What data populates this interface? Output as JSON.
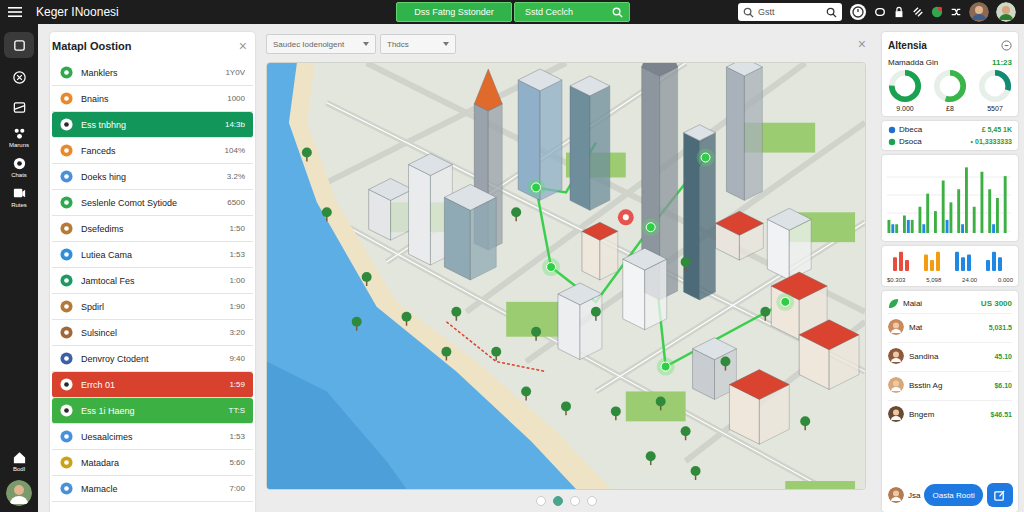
{
  "topbar": {
    "title": "Keger INoonesi",
    "action_button": "Dss Fatng Sstonder",
    "green_search": {
      "value": "Sstd Ceclch"
    },
    "search": {
      "placeholder": "Gstt"
    }
  },
  "rail": {
    "items": [
      {
        "label": "",
        "selected": true
      },
      {
        "label": "",
        "selected": false
      },
      {
        "label": "",
        "selected": false
      },
      {
        "label": "Maruns",
        "selected": false
      },
      {
        "label": "Chats",
        "selected": false
      },
      {
        "label": "Rutes",
        "selected": false
      }
    ],
    "bottom_label": "Bodl"
  },
  "left_panel": {
    "title": "Matapl Oostion",
    "close": "×",
    "items": [
      {
        "name": "Manklers",
        "value": "1Y0V",
        "kind": "plain",
        "color": "#2fa84f"
      },
      {
        "name": "Bnains",
        "value": "1000",
        "kind": "plain",
        "color": "#e8892b"
      },
      {
        "name": "Ess tnbhng",
        "value": "14:3b",
        "kind": "active",
        "color": "#ffffff"
      },
      {
        "name": "Fanceds",
        "value": "104%",
        "kind": "plain",
        "color": "#e8892b"
      },
      {
        "name": "Doeks hing",
        "value": "3.2%",
        "kind": "plain",
        "color": "#4a90d9"
      },
      {
        "name": "Seslenle Comot Sytiode",
        "value": "6500",
        "kind": "plain",
        "color": "#2fa84f"
      },
      {
        "name": "Dsefedims",
        "value": "1:50",
        "kind": "plain",
        "color": "#b5793a"
      },
      {
        "name": "Lutiea Cama",
        "value": "1:53",
        "kind": "plain",
        "color": "#2f8fd9"
      },
      {
        "name": "Jamtocal Fes",
        "value": "1:00",
        "kind": "plain",
        "color": "#1d9a63"
      },
      {
        "name": "Spdirl",
        "value": "1:90",
        "kind": "plain",
        "color": "#b5793a"
      },
      {
        "name": "Sulsincel",
        "value": "3:20",
        "kind": "plain",
        "color": "#a0673a"
      },
      {
        "name": "Denvroy Ctodent",
        "value": "9:40",
        "kind": "plain",
        "color": "#3d5fa8"
      },
      {
        "name": "Errch 01",
        "value": "1:59",
        "kind": "alert",
        "color": "#ffffff"
      },
      {
        "name": "Ess 1i Haeng",
        "value": "TT:S",
        "kind": "success",
        "color": "#ffffff"
      },
      {
        "name": "Uesaalcimes",
        "value": "1:53",
        "kind": "plain",
        "color": "#4a90d9"
      },
      {
        "name": "Matadara",
        "value": "5:60",
        "kind": "plain",
        "color": "#c9a21a"
      },
      {
        "name": "Mamacle",
        "value": "7:00",
        "kind": "plain",
        "color": "#4a90d9"
      }
    ]
  },
  "map": {
    "filters": [
      {
        "label": "Saudec Iodenolgent"
      },
      {
        "label": "Thdcs"
      }
    ],
    "close": "×",
    "pages": [
      {
        "selected": false
      },
      {
        "selected": true
      },
      {
        "selected": false
      },
      {
        "selected": false
      }
    ]
  },
  "right_panel": {
    "title": "Altensia",
    "summary": {
      "label": "Mamadda Gin",
      "value": "11:23"
    },
    "gauges": [
      {
        "level": 0.75,
        "label": "9.000",
        "color": "#1aa251"
      },
      {
        "level": 0.55,
        "label": "£8",
        "color": "#39b54a"
      },
      {
        "level": 0.3,
        "label": "5507",
        "color": "#138a72"
      }
    ],
    "stats": [
      {
        "label": "Dbeca",
        "value": "£ 5,45 1K"
      },
      {
        "label": "Dsoca",
        "value": "• 01,3333333"
      }
    ],
    "chart": {
      "max": 16,
      "series": [
        {
          "color": "#3cb043",
          "values": [
            3,
            2,
            4,
            3,
            6,
            9,
            5,
            12,
            7,
            10,
            15,
            6,
            14,
            10,
            8,
            13
          ]
        },
        {
          "color": "#1e88e5",
          "values": [
            2,
            0,
            3,
            0,
            2,
            0,
            0,
            3,
            0,
            2,
            0,
            0,
            0,
            2,
            0,
            0
          ]
        }
      ]
    },
    "mini_chart": {
      "max": 8,
      "groups": [
        {
          "color": "#e74c3c",
          "values": [
            5,
            7,
            4
          ]
        },
        {
          "color": "#f39c12",
          "values": [
            6,
            4,
            7
          ]
        },
        {
          "color": "#1e88e5",
          "values": [
            7,
            5,
            6
          ]
        },
        {
          "color": "#1e88e5",
          "values": [
            4,
            7,
            5
          ]
        }
      ],
      "labels": [
        "$0.303",
        "5,098",
        "24.00",
        "0.000"
      ]
    },
    "list_header": {
      "label": "Maiai",
      "value": "US 3000"
    },
    "people": [
      {
        "name": "Mat",
        "value": "5,031.5"
      },
      {
        "name": "Sandina",
        "value": "45.10"
      },
      {
        "name": "Bsstin Ag",
        "value": "$6.10"
      },
      {
        "name": "Bngem",
        "value": "$46.51"
      }
    ],
    "footer_person": {
      "name": "Jsa"
    },
    "button": "Oasta Rooti"
  }
}
